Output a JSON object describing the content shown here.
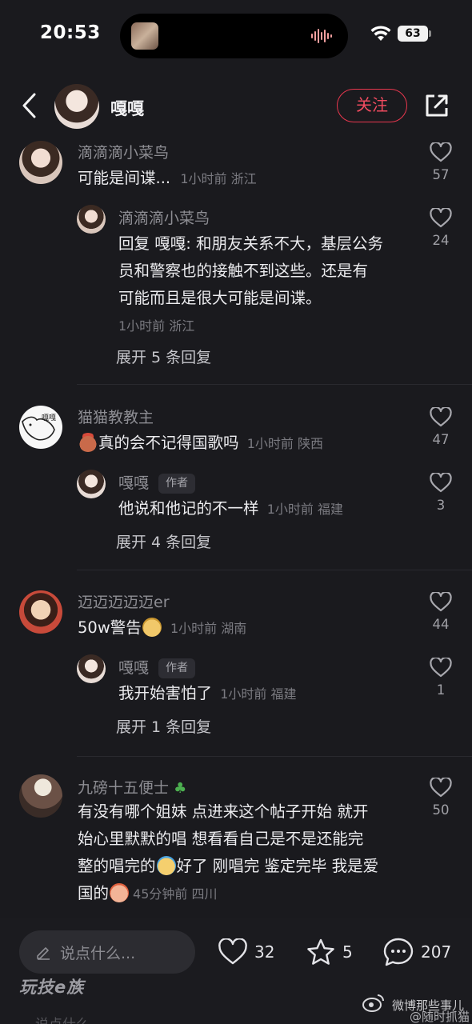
{
  "status": {
    "time": "20:53",
    "battery": "63"
  },
  "header": {
    "name": "嘎嘎",
    "follow_label": "关注"
  },
  "comments": [
    {
      "user": "滴滴滴小菜鸟",
      "text": "可能是间谍...",
      "meta": "1小时前 浙江",
      "likes": "57",
      "reply": {
        "user": "滴滴滴小菜鸟",
        "lines": [
          "回复 嘎嘎: 和朋友关系不大，基层公务",
          "员和警察也的接触不到这些。还是有",
          "可能而且是很大可能是间谍。"
        ],
        "meta": "1小时前 浙江",
        "likes": "24"
      },
      "expand": "展开 5 条回复"
    },
    {
      "user": "猫猫教教主",
      "text": "真的会不记得国歌吗",
      "meta": "1小时前 陕西",
      "likes": "47",
      "avatar_text": "嘎嘎",
      "reply": {
        "user": "嘎嘎",
        "tag": "作者",
        "text": "他说和他记的不一样",
        "meta": "1小时前 福建",
        "likes": "3"
      },
      "expand": "展开 4 条回复"
    },
    {
      "user": "迈迈迈迈迈er",
      "text": "50w警告",
      "meta": "1小时前 湖南",
      "likes": "44",
      "reply": {
        "user": "嘎嘎",
        "tag": "作者",
        "text": "我开始害怕了",
        "meta": "1小时前 福建",
        "likes": "1"
      },
      "expand": "展开 1 条回复"
    },
    {
      "user": "九磅十五便士",
      "lines": [
        "有没有哪个姐妹 点进来这个帖子开始 就开",
        "始心里默默的唱 想看看自己是不是还能完",
        "整的唱完的",
        "好了 刚唱完 鉴定完毕 我是爱",
        "国的"
      ],
      "meta": "45分钟前 四川",
      "likes": "50"
    }
  ],
  "bottom": {
    "placeholder": "说点什么...",
    "likes": "32",
    "stars": "5",
    "comments": "207",
    "watermark": "玩技e族",
    "weibo1": "微博那些事儿",
    "weibo2": "@随时抓猫",
    "ghost": "说点什么..."
  },
  "colors": {
    "accent": "#e8374e",
    "background": "#1a1a1e"
  }
}
